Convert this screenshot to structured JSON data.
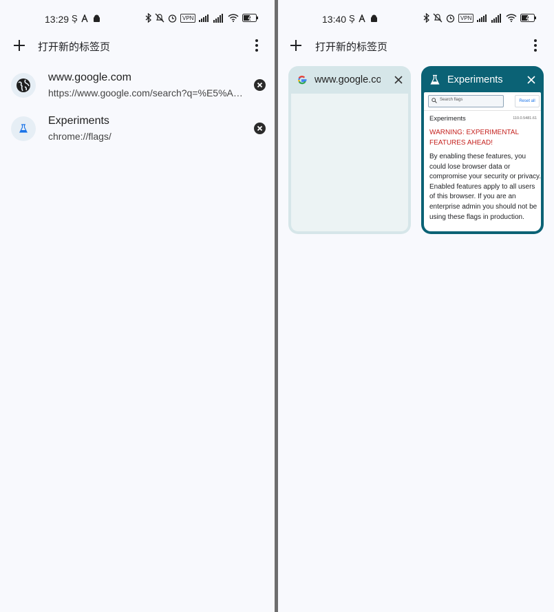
{
  "left": {
    "status": {
      "time": "13:29",
      "vpn": "VPN"
    },
    "toolbar": {
      "new_tab_label": "打开新的标签页"
    },
    "tabs": [
      {
        "title": "www.google.com",
        "url": "https://www.google.com/search?q=%E5%A…"
      },
      {
        "title": "Experiments",
        "url": "chrome://flags/"
      }
    ]
  },
  "right": {
    "status": {
      "time": "13:40",
      "vpn": "VPN"
    },
    "toolbar": {
      "new_tab_label": "打开新的标签页"
    },
    "cards": [
      {
        "title": "www.google.co",
        "icon": "google-g-icon"
      },
      {
        "title": "Experiments",
        "icon": "flask-icon",
        "preview": {
          "search_placeholder": "Search flags",
          "reset_label": "Reset all",
          "page_title": "Experiments",
          "version": "110.0.5481.61",
          "warning": "WARNING: EXPERIMENTAL FEATURES AHEAD!",
          "paragraph": "By enabling these features, you could lose browser data or compromise your security or privacy. Enabled features apply to all users of this browser. If you are an enterprise admin you should not be using these flags in production."
        }
      }
    ]
  },
  "colors": {
    "background": "#f8f9fd",
    "active_card": "#0b6275",
    "inactive_card": "#d6e6e9",
    "warning_text": "#c5221f",
    "flask_blue": "#1a73e8"
  },
  "icons": [
    "plus-icon",
    "more-vert-icon",
    "globe-icon",
    "flask-icon",
    "close-circle-icon",
    "close-icon",
    "google-g-icon",
    "bluetooth-icon",
    "mute-icon",
    "alarm-icon",
    "signal-icon",
    "wifi-icon",
    "battery-icon",
    "search-icon"
  ]
}
